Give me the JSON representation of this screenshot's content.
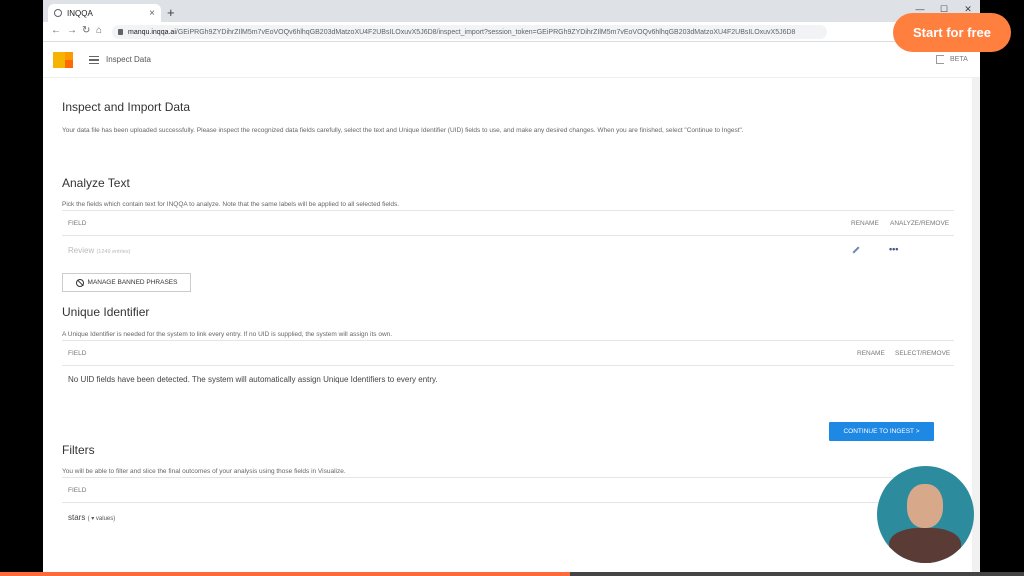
{
  "browser": {
    "tab_title": "INQQA",
    "tab_close": "×",
    "new_tab": "+",
    "url_host": "manqu.inqqa.ai",
    "url_path": "/GEiPRGh9ZYDihrZIlM5m7vEoVOQv6hlhqGB203dMatzoXU4F2UBsILOxuvX5J6D8/inspect_import?session_token=GEiPRGh9ZYDihrZIlM5m7vEoVOQv6hlhqGB203dMatzoXU4F2UBsILOxuvX5J6D8"
  },
  "header": {
    "title": "Inspect Data",
    "beta": "BETA"
  },
  "inspect": {
    "title": "Inspect and Import Data",
    "desc": "Your data file has been uploaded successfully. Please inspect the recognized data fields carefully, select the text and Unique Identifier (UID) fields to use, and make any desired changes. When you are finished, select \"Continue to Ingest\"."
  },
  "analyze": {
    "title": "Analyze Text",
    "desc": "Pick the fields which contain text for INQQA to analyze. Note that the same labels will be applied to all selected fields.",
    "col_field": "FIELD",
    "col_rename": "RENAME",
    "col_action": "ANALYZE/REMOVE",
    "row_name": "Review",
    "row_count": "(1249 entries)",
    "more": "•••",
    "ban_button": "MANAGE BANNED PHRASES"
  },
  "uid": {
    "title": "Unique Identifier",
    "desc": "A Unique Identifier is needed for the system to link every entry. If no UID is supplied, the system will assign its own.",
    "col_field": "FIELD",
    "col_rename": "RENAME",
    "col_action": "SELECT/REMOVE",
    "empty": "No UID fields have been detected. The system will automatically assign Unique Identifiers to every entry."
  },
  "continue_button": "CONTINUE TO INGEST >",
  "filters": {
    "title": "Filters",
    "desc": "You will be able to filter and slice the final outcomes of your analysis using those fields in Visualize.",
    "col_field": "FIELD",
    "row_name": "stars",
    "row_values": "( ▾ values)"
  },
  "overlay": {
    "cta": "Start for free",
    "progress": 0.557
  }
}
